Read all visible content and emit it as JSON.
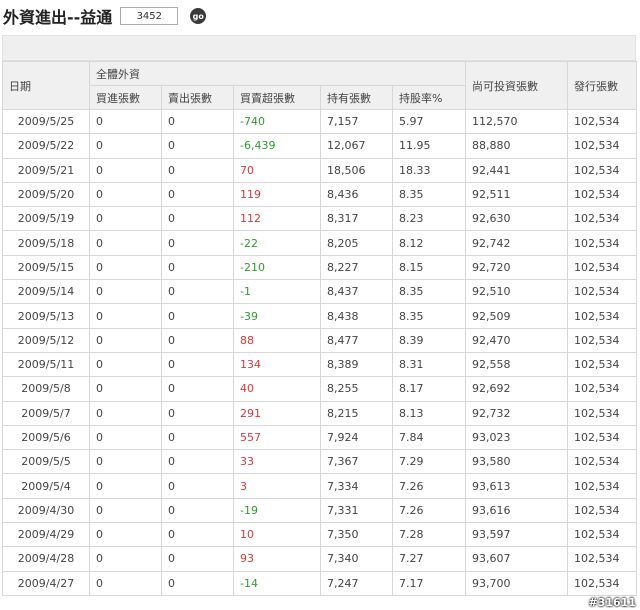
{
  "header": {
    "title": "外資進出--益通",
    "stock_code": "3452",
    "go_label": "go"
  },
  "table": {
    "headers": {
      "date": "日期",
      "group": "全體外資",
      "buy": "買進張數",
      "sell": "賣出張數",
      "net": "買賣超張數",
      "hold": "持有張數",
      "pct": "持股率%",
      "remain": "尚可投資張數",
      "issued": "發行張數"
    },
    "rows": [
      {
        "date": "2009/5/25",
        "buy": "0",
        "sell": "0",
        "net": "-740",
        "hold": "7,157",
        "pct": "5.97",
        "remain": "112,570",
        "issued": "102,534"
      },
      {
        "date": "2009/5/22",
        "buy": "0",
        "sell": "0",
        "net": "-6,439",
        "hold": "12,067",
        "pct": "11.95",
        "remain": "88,880",
        "issued": "102,534"
      },
      {
        "date": "2009/5/21",
        "buy": "0",
        "sell": "0",
        "net": "70",
        "hold": "18,506",
        "pct": "18.33",
        "remain": "92,441",
        "issued": "102,534"
      },
      {
        "date": "2009/5/20",
        "buy": "0",
        "sell": "0",
        "net": "119",
        "hold": "8,436",
        "pct": "8.35",
        "remain": "92,511",
        "issued": "102,534"
      },
      {
        "date": "2009/5/19",
        "buy": "0",
        "sell": "0",
        "net": "112",
        "hold": "8,317",
        "pct": "8.23",
        "remain": "92,630",
        "issued": "102,534"
      },
      {
        "date": "2009/5/18",
        "buy": "0",
        "sell": "0",
        "net": "-22",
        "hold": "8,205",
        "pct": "8.12",
        "remain": "92,742",
        "issued": "102,534"
      },
      {
        "date": "2009/5/15",
        "buy": "0",
        "sell": "0",
        "net": "-210",
        "hold": "8,227",
        "pct": "8.15",
        "remain": "92,720",
        "issued": "102,534"
      },
      {
        "date": "2009/5/14",
        "buy": "0",
        "sell": "0",
        "net": "-1",
        "hold": "8,437",
        "pct": "8.35",
        "remain": "92,510",
        "issued": "102,534"
      },
      {
        "date": "2009/5/13",
        "buy": "0",
        "sell": "0",
        "net": "-39",
        "hold": "8,438",
        "pct": "8.35",
        "remain": "92,509",
        "issued": "102,534"
      },
      {
        "date": "2009/5/12",
        "buy": "0",
        "sell": "0",
        "net": "88",
        "hold": "8,477",
        "pct": "8.39",
        "remain": "92,470",
        "issued": "102,534"
      },
      {
        "date": "2009/5/11",
        "buy": "0",
        "sell": "0",
        "net": "134",
        "hold": "8,389",
        "pct": "8.31",
        "remain": "92,558",
        "issued": "102,534"
      },
      {
        "date": "2009/5/8",
        "buy": "0",
        "sell": "0",
        "net": "40",
        "hold": "8,255",
        "pct": "8.17",
        "remain": "92,692",
        "issued": "102,534"
      },
      {
        "date": "2009/5/7",
        "buy": "0",
        "sell": "0",
        "net": "291",
        "hold": "8,215",
        "pct": "8.13",
        "remain": "92,732",
        "issued": "102,534"
      },
      {
        "date": "2009/5/6",
        "buy": "0",
        "sell": "0",
        "net": "557",
        "hold": "7,924",
        "pct": "7.84",
        "remain": "93,023",
        "issued": "102,534"
      },
      {
        "date": "2009/5/5",
        "buy": "0",
        "sell": "0",
        "net": "33",
        "hold": "7,367",
        "pct": "7.29",
        "remain": "93,580",
        "issued": "102,534"
      },
      {
        "date": "2009/5/4",
        "buy": "0",
        "sell": "0",
        "net": "3",
        "hold": "7,334",
        "pct": "7.26",
        "remain": "93,613",
        "issued": "102,534"
      },
      {
        "date": "2009/4/30",
        "buy": "0",
        "sell": "0",
        "net": "-19",
        "hold": "7,331",
        "pct": "7.26",
        "remain": "93,616",
        "issued": "102,534"
      },
      {
        "date": "2009/4/29",
        "buy": "0",
        "sell": "0",
        "net": "10",
        "hold": "7,350",
        "pct": "7.28",
        "remain": "93,597",
        "issued": "102,534"
      },
      {
        "date": "2009/4/28",
        "buy": "0",
        "sell": "0",
        "net": "93",
        "hold": "7,340",
        "pct": "7.27",
        "remain": "93,607",
        "issued": "102,534"
      },
      {
        "date": "2009/4/27",
        "buy": "0",
        "sell": "0",
        "net": "-14",
        "hold": "7,247",
        "pct": "7.17",
        "remain": "93,700",
        "issued": "102,534"
      }
    ]
  },
  "colors": {
    "positive": "#d03a3a",
    "negative": "#2f9a2f"
  },
  "watermark": "#31611"
}
